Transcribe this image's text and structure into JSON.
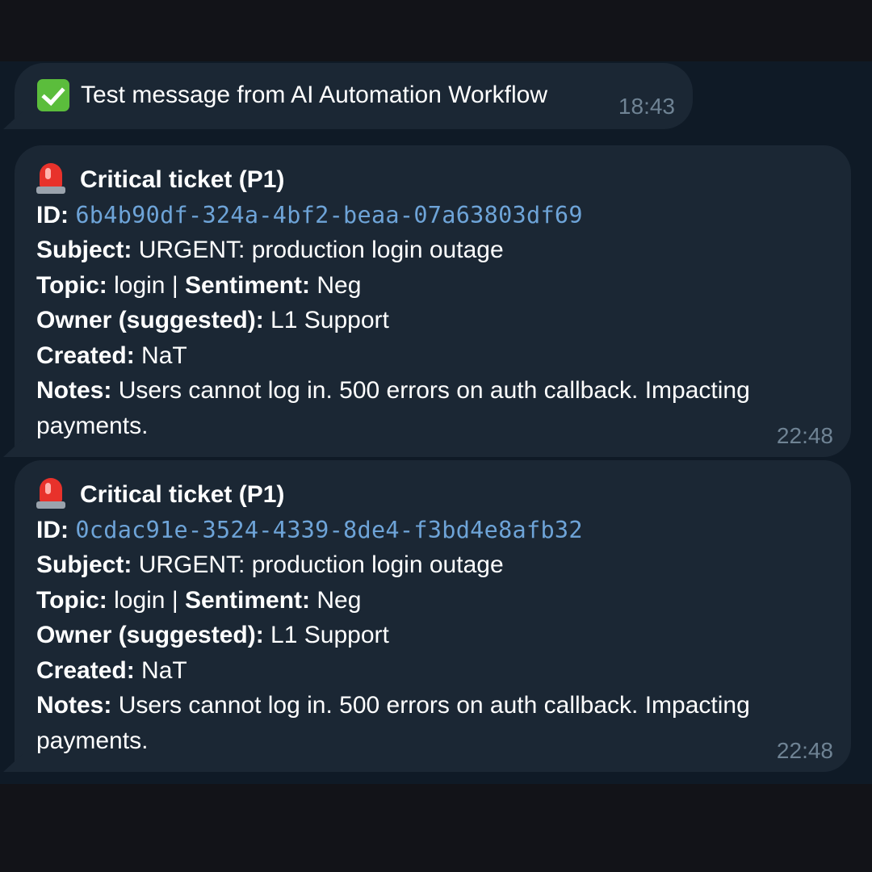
{
  "messages": [
    {
      "icon": "check-mark-icon",
      "text": "Test message from AI Automation Workflow",
      "time": "18:43"
    }
  ],
  "tickets": [
    {
      "icon": "police-siren-icon",
      "title": "Critical ticket (P1)",
      "id_label": "ID:",
      "id": "6b4b90df-324a-4bf2-beaa-07a63803df69",
      "subject_label": "Subject:",
      "subject": "URGENT: production login outage",
      "topic_label": "Topic:",
      "topic": "login",
      "separator": "|",
      "sentiment_label": "Sentiment:",
      "sentiment": "Neg",
      "owner_label": "Owner (suggested):",
      "owner": "L1 Support",
      "created_label": "Created:",
      "created": "NaT",
      "notes_label": "Notes:",
      "notes": "Users cannot log in. 500 errors on auth callback. Impacting payments.",
      "time": "22:48"
    },
    {
      "icon": "police-siren-icon",
      "title": "Critical ticket (P1)",
      "id_label": "ID:",
      "id": "0cdac91e-3524-4339-8de4-f3bd4e8afb32",
      "subject_label": "Subject:",
      "subject": "URGENT: production login outage",
      "topic_label": "Topic:",
      "topic": "login",
      "separator": "|",
      "sentiment_label": "Sentiment:",
      "sentiment": "Neg",
      "owner_label": "Owner (suggested):",
      "owner": "L1 Support",
      "created_label": "Created:",
      "created": "NaT",
      "notes_label": "Notes:",
      "notes": "Users cannot log in. 500 errors on auth callback. Impacting payments.",
      "time": "22:48"
    }
  ],
  "colors": {
    "page_background": "#121318",
    "chat_background": "#0f1a26",
    "bubble_background": "#1b2734",
    "id_link": "#6ea4d8",
    "timestamp": "#6f8394",
    "check_green": "#5bbd3c",
    "siren_red": "#e8322b"
  }
}
